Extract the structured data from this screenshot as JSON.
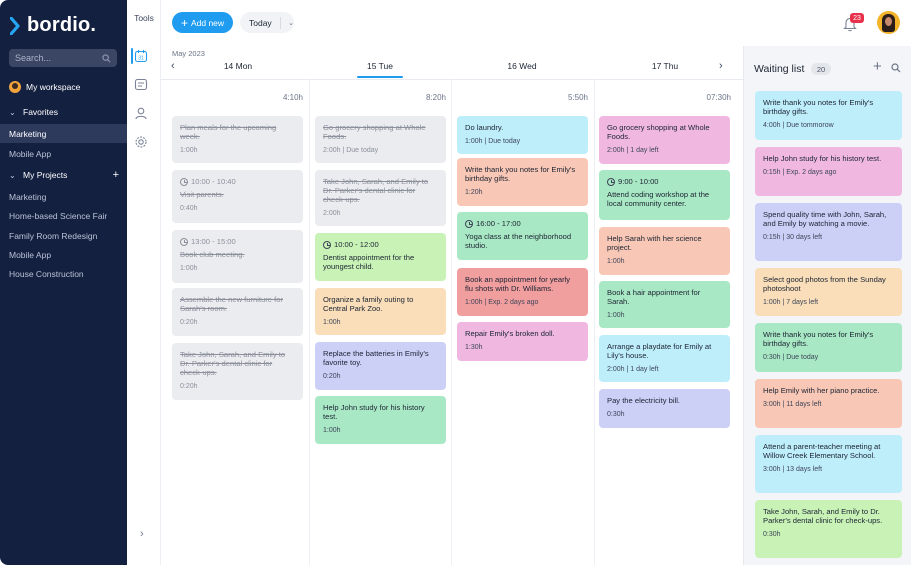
{
  "brand": {
    "name": "bordio."
  },
  "sidebar": {
    "search_placeholder": "Search...",
    "workspace": "My workspace",
    "favorites": {
      "label": "Favorites",
      "items": [
        "Marketing",
        "Mobile App"
      ]
    },
    "projects": {
      "label": "My Projects",
      "items": [
        "Marketing",
        "Home-based Science Fair",
        "Family Room Redesign",
        "Mobile App",
        "House Construction"
      ]
    }
  },
  "tools": {
    "title": "Tools"
  },
  "topbar": {
    "add_label": "Add new",
    "today_label": "Today",
    "notification_count": "23"
  },
  "calendar": {
    "month": "May 2023",
    "days": [
      "14 Mon",
      "15 Tue",
      "16 Wed",
      "17 Thu"
    ],
    "hours": [
      "4:10h",
      "8:20h",
      "5:50h",
      "07:30h"
    ],
    "columns": [
      [
        {
          "title": "Plan meals for the upcoming week.",
          "meta": "1:00h",
          "done": true,
          "color": "#ebecef"
        },
        {
          "time": "10:00 - 10:40",
          "title": "Visit parents.",
          "meta": "0:40h",
          "done": true,
          "color": "#ebecef"
        },
        {
          "time": "13:00 - 15:00",
          "title": "Book club meeting.",
          "meta": "1:00h",
          "done": true,
          "color": "#ebecef"
        },
        {
          "title": "Assemble the new furniture for Sarah's room.",
          "meta": "0:20h",
          "done": true,
          "color": "#ebecef"
        },
        {
          "title": "Take John, Sarah, and Emily to Dr. Parker's dental clinic for check-ups.",
          "meta": "0:20h",
          "done": true,
          "color": "#ebecef"
        }
      ],
      [
        {
          "title": "Go grocery shopping at Whole Foods.",
          "meta": "2:00h | Due today",
          "done": true,
          "color": "#ebecef"
        },
        {
          "title": "Take John, Sarah, and Emily to Dr. Parker's dental clinic for check-ups.",
          "meta": "2:00h",
          "done": true,
          "color": "#ebecef"
        },
        {
          "time": "10:00 - 12:00",
          "title": "Dentist appointment for the youngest child.",
          "meta": "",
          "done": false,
          "color": "#c9f3b6"
        },
        {
          "title": "Organize a family outing to Central Park Zoo.",
          "meta": "1:00h",
          "done": false,
          "color": "#f9deb9"
        },
        {
          "title": "Replace the batteries in Emily's favorite toy.",
          "meta": "0:20h",
          "done": false,
          "color": "#ccd0f7"
        },
        {
          "title": "Help John study for his history test.",
          "meta": "1:00h",
          "done": false,
          "color": "#a9e8c5"
        }
      ],
      [
        {
          "title": "Do laundry.",
          "meta": "1:00h | Due today",
          "done": false,
          "color": "#bfeefb"
        },
        {
          "title": "Write thank you notes for Emily's birthday gifts.",
          "meta": "1:20h",
          "done": false,
          "color": "#f8c7b5"
        },
        {
          "time": "16:00 - 17:00",
          "title": "Yoga class at the neighborhood studio.",
          "meta": "",
          "done": false,
          "color": "#a9e8c5"
        },
        {
          "title": "Book an appointment for yearly flu shots with Dr. Williams.",
          "meta": "1:00h | Exp. 2 days ago",
          "done": false,
          "color": "#f19e9f"
        },
        {
          "title": "Repair Emily's broken doll.",
          "meta": "1:30h",
          "done": false,
          "color": "#f0b8e1"
        }
      ],
      [
        {
          "title": "Go grocery shopping at Whole Foods.",
          "meta": "2:00h | 1 day left",
          "done": false,
          "color": "#f0b8e1"
        },
        {
          "time": "9:00 - 10:00",
          "title": "Attend coding workshop at the local community center.",
          "meta": "",
          "done": false,
          "color": "#a9e8c5"
        },
        {
          "title": "Help Sarah with her science project.",
          "meta": "1:00h",
          "done": false,
          "color": "#f8c7b5"
        },
        {
          "title": "Book a hair appointment for Sarah.",
          "meta": "1:00h",
          "done": false,
          "color": "#a9e8c5"
        },
        {
          "title": "Arrange a playdate for Emily at Lily's house.",
          "meta": "2:00h | 1 day left",
          "done": false,
          "color": "#bfeefb"
        },
        {
          "title": "Pay the electricity bill.",
          "meta": "0:30h",
          "done": false,
          "color": "#ccd0f7"
        }
      ]
    ]
  },
  "waiting_list": {
    "title": "Waiting list",
    "count": "20",
    "items": [
      {
        "title": "Write thank you notes for Emily's birthday gifts.",
        "meta": "4:00h | Due tommorow",
        "color": "#bfeefb"
      },
      {
        "title": "Help John study for his history test.",
        "meta": "0:15h | Exp. 2 days ago",
        "color": "#f0b8e1"
      },
      {
        "title": "Spend quality time with John, Sarah, and Emily by watching a movie.",
        "meta": "0:15h | 30 days left",
        "color": "#ccd0f7"
      },
      {
        "title": "Select good photos from the Sunday photoshoot",
        "meta": "1:00h | 7 days left",
        "color": "#f9deb9"
      },
      {
        "title": "Write thank you notes for Emily's birthday gifts.",
        "meta": "0:30h | Due today",
        "color": "#a9e8c5"
      },
      {
        "title": "Help Emily with her piano practice.",
        "meta": "3:00h | 11 days left",
        "color": "#f8c7b5"
      },
      {
        "title": "Attend a parent-teacher meeting at Willow Creek Elementary School.",
        "meta": "3:00h | 13 days left",
        "color": "#bfeefb"
      },
      {
        "title": "Take John, Sarah, and Emily to Dr. Parker's dental clinic for check-ups.",
        "meta": "0:30h",
        "color": "#c9f3b6"
      }
    ]
  }
}
